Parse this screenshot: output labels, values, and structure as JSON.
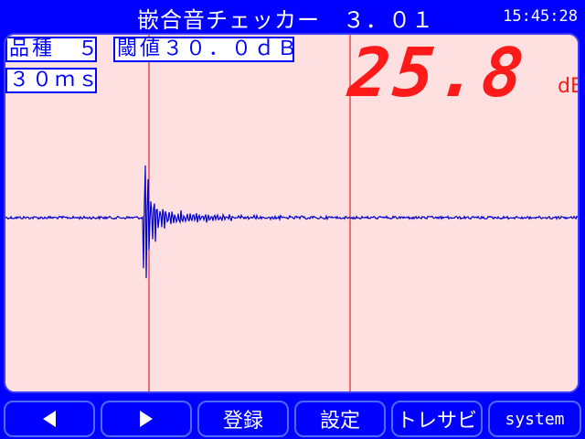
{
  "header": {
    "title": "嵌合音チェッカー　３．０１",
    "clock": "15:45:28"
  },
  "labels": {
    "hinshu": "品種　５",
    "threshold": "閾値３０．０ｄＢ",
    "time": "３０ｍｓ"
  },
  "readout": {
    "value": "25.8",
    "unit": "dB"
  },
  "toolbar": {
    "prev_icon": "triangle-left-icon",
    "next_icon": "triangle-right-icon",
    "register_label": "登録",
    "settings_label": "設定",
    "trace_label": "トレサビ",
    "system_label": "system"
  },
  "colors": {
    "background": "#0000ff",
    "panel": "#ffe0e0",
    "readout": "#ff1a1a",
    "waveform": "#0000cc",
    "marker_line": "#e00000"
  }
}
